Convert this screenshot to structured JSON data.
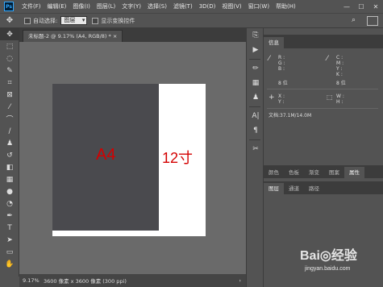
{
  "app": {
    "logo": "Ps"
  },
  "menu": [
    "文件(F)",
    "编辑(E)",
    "图像(I)",
    "图层(L)",
    "文字(Y)",
    "选择(S)",
    "滤镜(T)",
    "3D(D)",
    "视图(V)",
    "窗口(W)",
    "帮助(H)"
  ],
  "window": {
    "minimize": "—",
    "maximize": "☐",
    "close": "✕"
  },
  "options": {
    "auto_select": "自动选择:",
    "auto_select_value": "图层",
    "show_transform": "显示变换控件"
  },
  "tab": {
    "title": "未标题-2 @ 9.17% (A4, RGB/8) *",
    "close": "×"
  },
  "canvas": {
    "a4_label": "A4",
    "inch_label": "12寸",
    "colors": {
      "a4": "#4a4a4e",
      "paper": "#ffffff",
      "text": "#d40000"
    }
  },
  "status": {
    "zoom": "9.17%",
    "doc_size": "3600 像素 x 3600 像素 (300 ppi)",
    "arrow": "›"
  },
  "info_panel": {
    "tab": "信息",
    "r": "R :",
    "g": "G :",
    "b": "B :",
    "c": "C :",
    "m": "M :",
    "y": "Y :",
    "k": "K :",
    "bit1": "8 位",
    "bit2": "8 位",
    "x": "X :",
    "yy": "Y :",
    "w": "W :",
    "h": "H :",
    "doc": "文档:37.1M/14.0M"
  },
  "panel2_tabs": [
    "颜色",
    "色板",
    "渐变",
    "图案",
    "属性"
  ],
  "panel3_tabs": [
    "图层",
    "通道",
    "路径"
  ],
  "watermark": {
    "text": "Bai◎经验",
    "sub": "jingyan.baidu.com"
  }
}
